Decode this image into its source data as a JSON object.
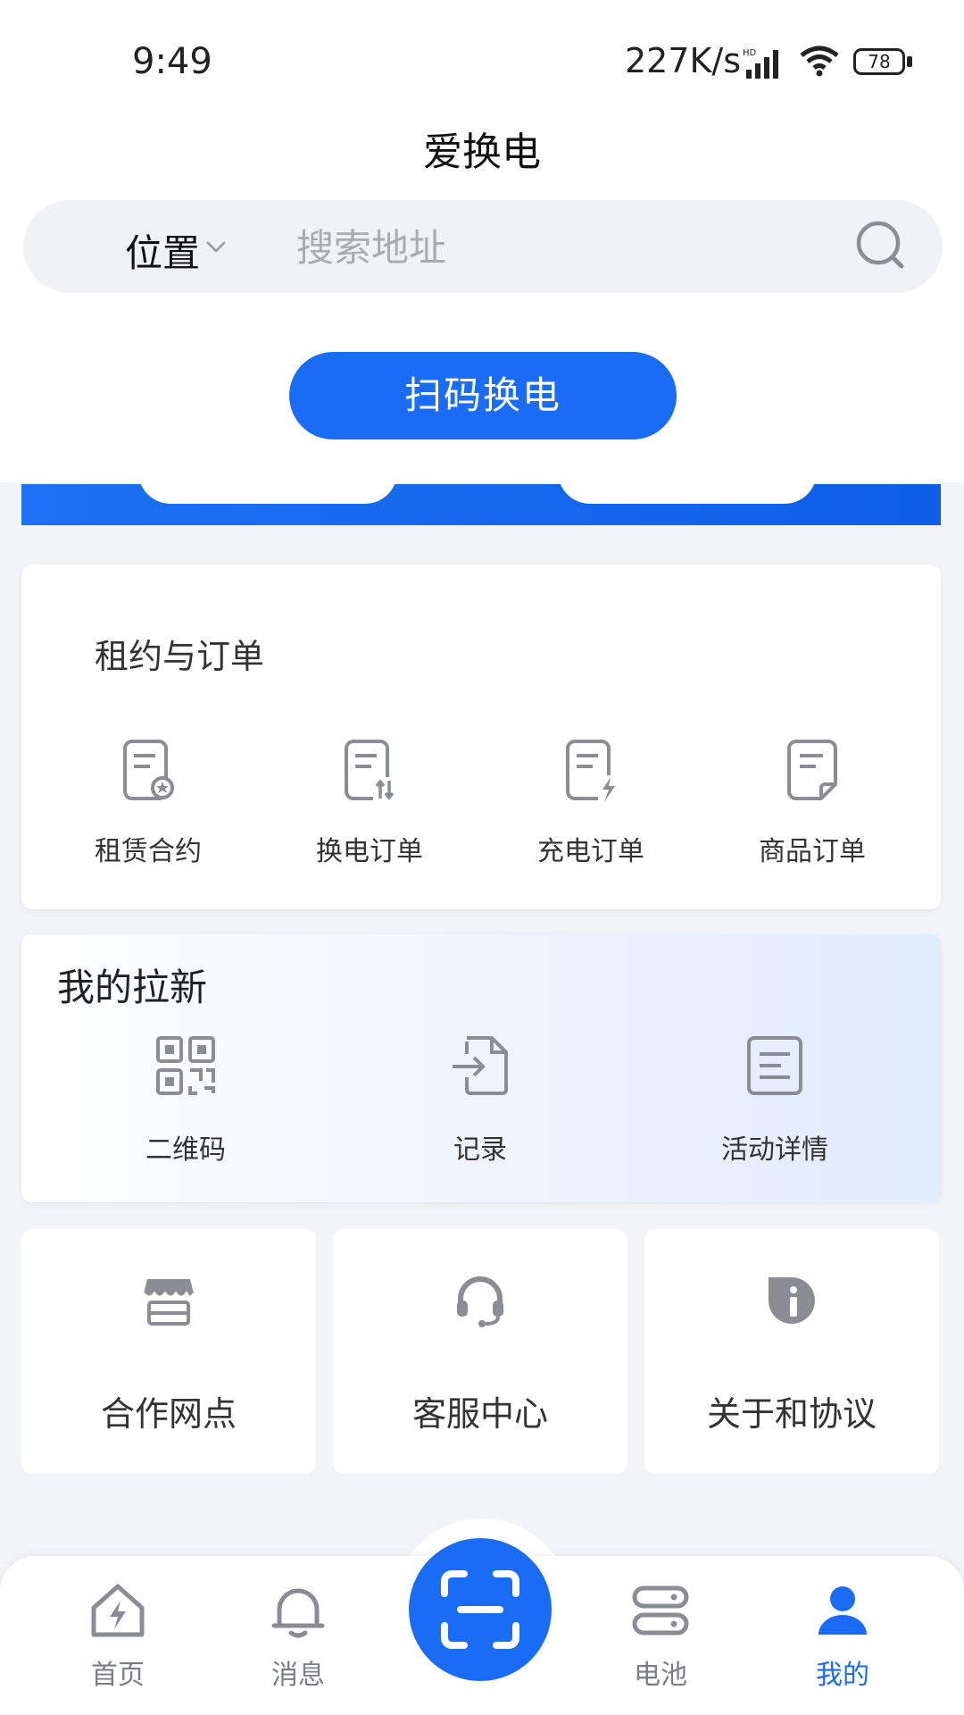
{
  "status_bar": {
    "time": "9:49",
    "network_speed": "227K/s",
    "battery": "78"
  },
  "app": {
    "title": "爱换电"
  },
  "search": {
    "location_label": "位置",
    "placeholder": "搜索地址"
  },
  "primary_action": {
    "label": "扫码换电"
  },
  "orders": {
    "title": "租约与订单",
    "items": [
      {
        "label": "租赁合约",
        "icon": "contract-icon"
      },
      {
        "label": "换电订单",
        "icon": "swap-order-icon"
      },
      {
        "label": "充电订单",
        "icon": "charge-order-icon"
      },
      {
        "label": "商品订单",
        "icon": "goods-order-icon"
      }
    ]
  },
  "invite": {
    "title": "我的拉新",
    "items": [
      {
        "label": "二维码",
        "icon": "qrcode-icon"
      },
      {
        "label": "记录",
        "icon": "record-icon"
      },
      {
        "label": "活动详情",
        "icon": "activity-detail-icon"
      }
    ]
  },
  "tiles": [
    {
      "label": "合作网点",
      "icon": "store-icon"
    },
    {
      "label": "客服中心",
      "icon": "headset-icon"
    },
    {
      "label": "关于和协议",
      "icon": "info-icon"
    }
  ],
  "tabbar": {
    "items": [
      {
        "label": "首页",
        "icon": "home-icon",
        "active": false
      },
      {
        "label": "消息",
        "icon": "bell-icon",
        "active": false
      },
      {
        "label": "电池",
        "icon": "battery-icon",
        "active": false
      },
      {
        "label": "我的",
        "icon": "user-icon",
        "active": true
      }
    ],
    "center_icon": "scan-icon"
  },
  "colors": {
    "accent": "#1a6cf5",
    "icon_gray": "#8a8d93",
    "background": "#f2f4f8"
  }
}
